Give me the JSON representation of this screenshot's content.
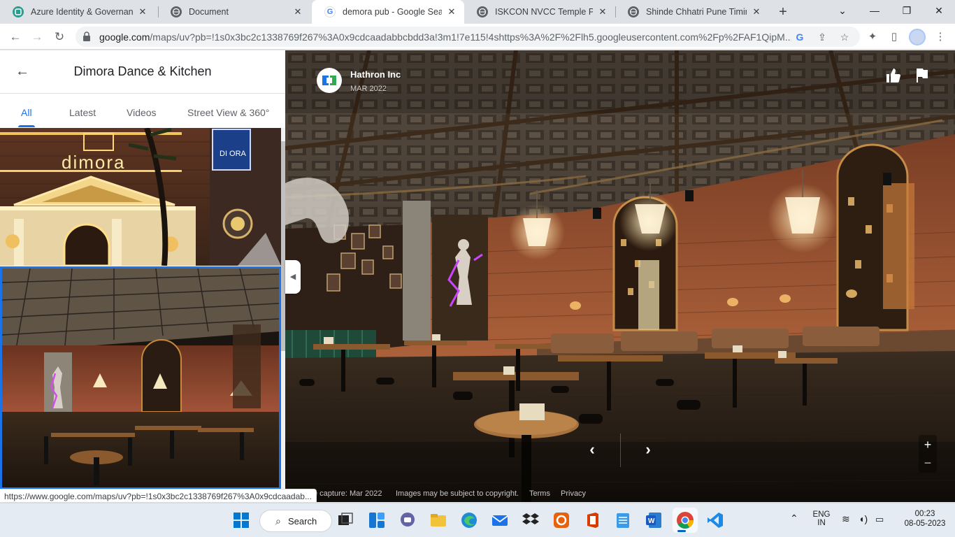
{
  "browser": {
    "tabs": [
      {
        "title": "Azure Identity & Governance",
        "favicon": "azure-favicon",
        "active": false
      },
      {
        "title": "Document",
        "favicon": "globe-favicon",
        "active": false
      },
      {
        "title": "demora pub - Google Search",
        "favicon": "google-favicon",
        "active": true
      },
      {
        "title": "ISKCON NVCC Temple Pune",
        "favicon": "globe-favicon",
        "active": false
      },
      {
        "title": "Shinde Chhatri Pune Timings",
        "favicon": "globe-favicon",
        "active": false
      }
    ],
    "url_domain": "google.com",
    "url_path": "/maps/uv?pb=!1s0x3bc2c1338769f267%3A0x9cdcaadabbcbdd3a!3m1!7e115!4shttps%3A%2F%2Flh5.googleusercontent.com%2Fp%2FAF1QipM..."
  },
  "panel": {
    "title": "Dimora Dance & Kitchen",
    "tabs": [
      {
        "label": "All",
        "selected": true
      },
      {
        "label": "Latest",
        "selected": false
      },
      {
        "label": "Videos",
        "selected": false
      },
      {
        "label": "Street View & 360°",
        "selected": false
      }
    ]
  },
  "photo": {
    "author": "Hathron Inc",
    "date": "MAR 2022"
  },
  "attribution": {
    "capture": "e capture: Mar 2022",
    "copyright": "Images may be subject to copyright.",
    "terms": "Terms",
    "privacy": "Privacy"
  },
  "status_url": "https://www.google.com/maps/uv?pb=!1s0x3bc2c1338769f267%3A0x9cdcaadab...",
  "taskbar": {
    "search_label": "Search",
    "lang": "ENG",
    "region": "IN",
    "time": "00:23",
    "date": "08-05-2023"
  },
  "colors": {
    "accent": "#1a73e8",
    "tabstrip": "#dee1e6",
    "taskbar": "#e5ebf2"
  }
}
